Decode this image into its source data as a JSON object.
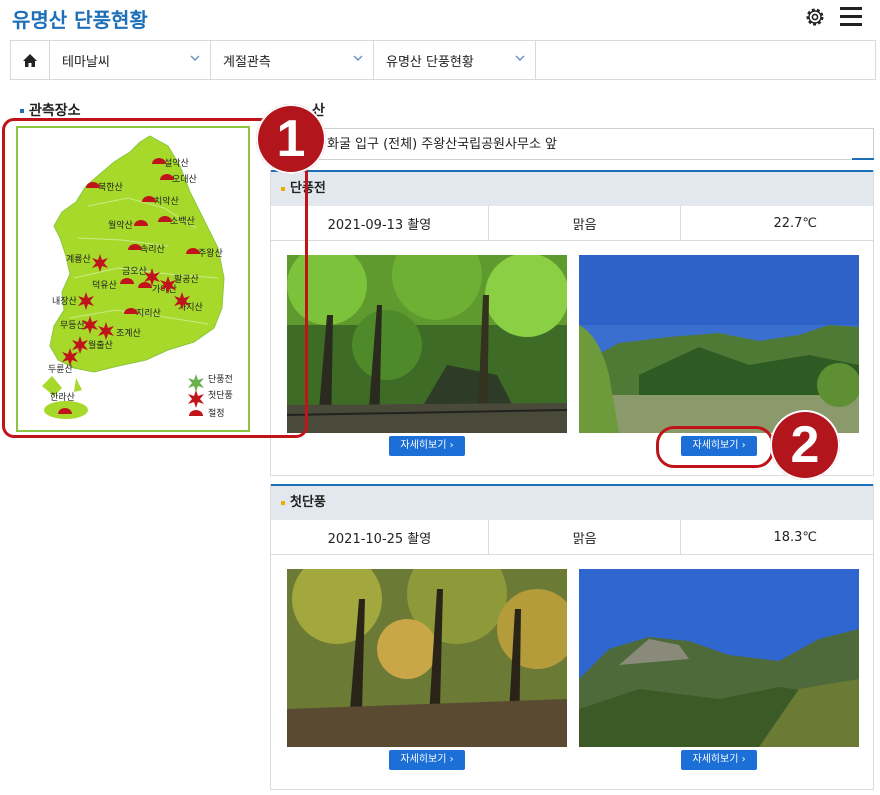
{
  "header": {
    "title": "유명산 단풍현황"
  },
  "nav": {
    "items": [
      "테마날씨",
      "계절관측",
      "유명산 단풍현황"
    ]
  },
  "left": {
    "section_label": "관측장소",
    "places": [
      "설악산",
      "오대산",
      "북한산",
      "치악산",
      "소백산",
      "월악산",
      "속리산",
      "주왕산",
      "계룡산",
      "금오산",
      "팔공산",
      "가야산",
      "덕유산",
      "가지산",
      "내장산",
      "지리산",
      "무등산",
      "조계산",
      "월출산",
      "두륜산",
      "한라산"
    ],
    "legend": [
      "단풍전",
      "첫단풍",
      "절정"
    ]
  },
  "right": {
    "section_label_fragment": "산",
    "selected_location": "화굴 입구 (전체) 주왕산국립공원사무소 앞",
    "panels": [
      {
        "title": "단풍전",
        "date": "2021-09-13 촬영",
        "weather": "맑음",
        "temperature": "22.7℃",
        "buttons": [
          "자세히보기 ›",
          "자세히보기 ›"
        ]
      },
      {
        "title": "첫단풍",
        "date": "2021-10-25 촬영",
        "weather": "맑음",
        "temperature": "18.3℃",
        "buttons": [
          "자세히보기 ›",
          "자세히보기 ›"
        ]
      }
    ]
  },
  "annotations": [
    "1",
    "2"
  ],
  "colors": {
    "accent": "#1d6fb8",
    "map_green": "#a6d92a",
    "marker_red": "#c0141b",
    "button_blue": "#1c6fd6"
  }
}
